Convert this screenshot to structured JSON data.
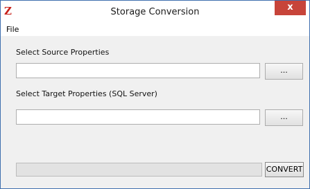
{
  "window": {
    "title": "Storage Conversion",
    "app_icon": "Z",
    "close_label": "x"
  },
  "menu": {
    "items": [
      {
        "label": "File"
      }
    ]
  },
  "source": {
    "label": "Select Source Properties",
    "value": "",
    "browse_label": "..."
  },
  "target": {
    "label": "Select Target Properties (SQL Server)",
    "value": "",
    "browse_label": "..."
  },
  "progress": {
    "percent": 0
  },
  "actions": {
    "convert_label": "CONVERT"
  },
  "colors": {
    "icon_red": "#c8201a",
    "close_red": "#c7443a",
    "border_blue": "#3f6fae",
    "panel_bg": "#f0f0f0"
  }
}
